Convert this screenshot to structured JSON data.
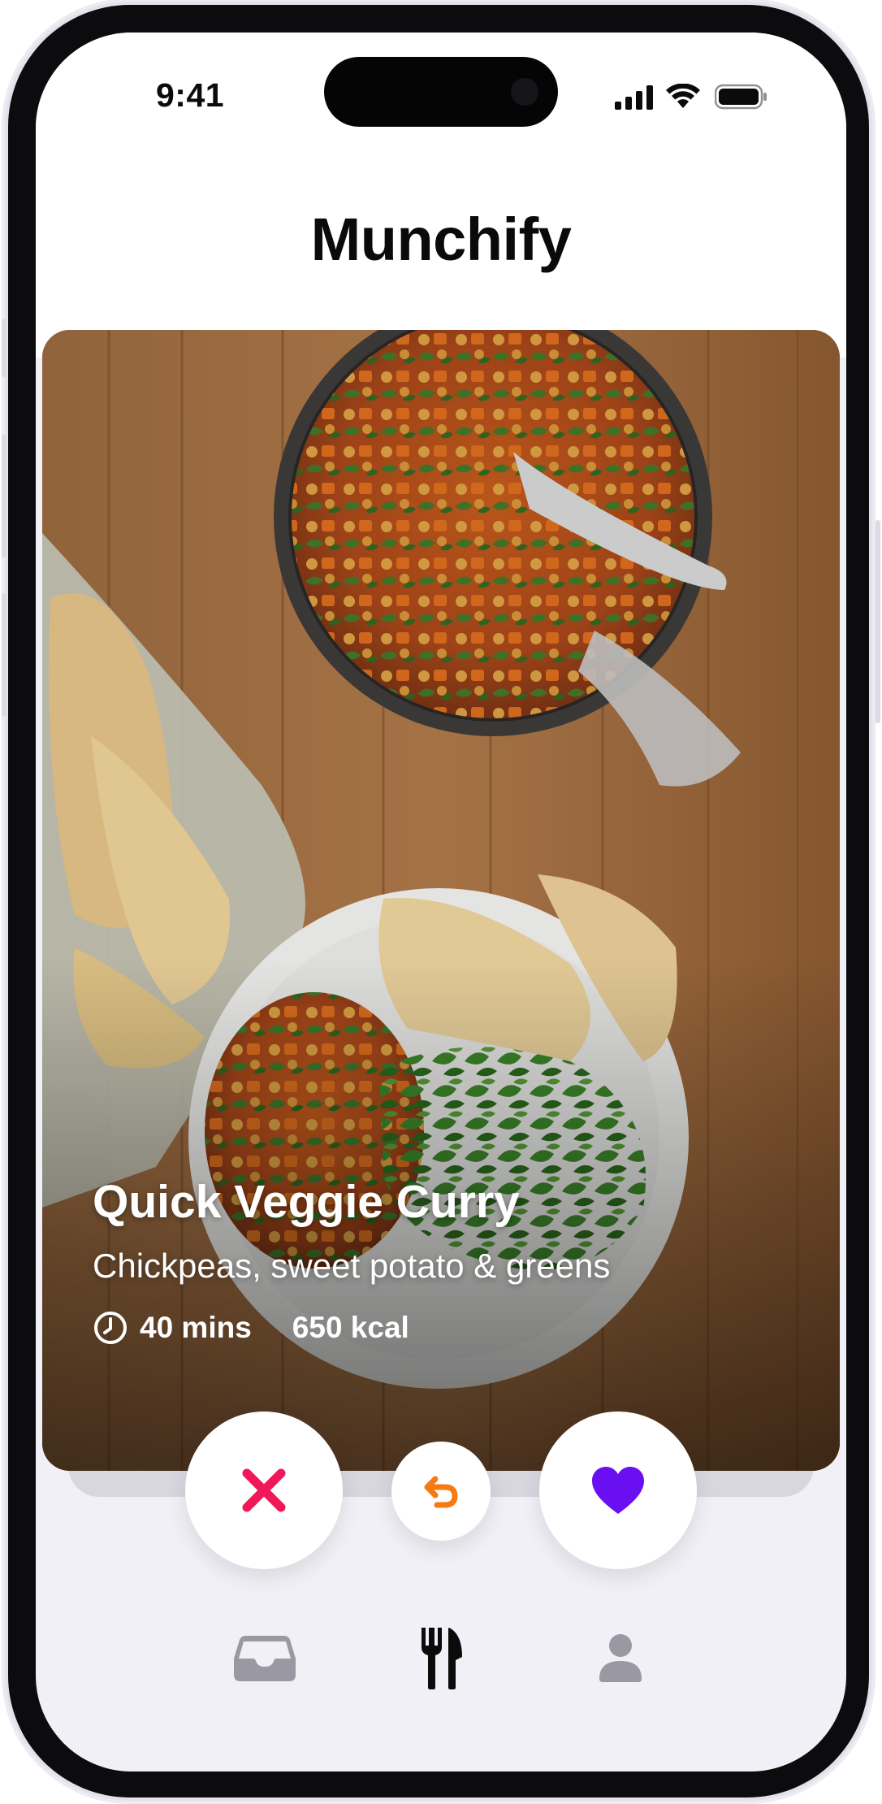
{
  "status_bar": {
    "time": "9:41",
    "icons": [
      "cellular-signal-icon",
      "wifi-icon",
      "battery-icon"
    ]
  },
  "header": {
    "title": "Munchify"
  },
  "recipe_card": {
    "title": "Quick Veggie Curry",
    "subtitle": "Chickpeas, sweet potato & greens",
    "time": "40 mins",
    "calories": "650 kcal",
    "time_icon": "clock-icon"
  },
  "actions": {
    "dislike_icon": "close-x-icon",
    "undo_icon": "undo-icon",
    "like_icon": "heart-icon",
    "colors": {
      "dislike": "#f01858",
      "undo": "#f57a12",
      "like": "#6a0ff2"
    }
  },
  "tab_bar": {
    "items": [
      {
        "icon": "inbox-tray-icon",
        "active": false
      },
      {
        "icon": "fork-knife-icon",
        "active": true
      },
      {
        "icon": "profile-icon",
        "active": false
      }
    ],
    "colors": {
      "active": "#0b0b0b",
      "inactive": "#9a99a3"
    }
  }
}
